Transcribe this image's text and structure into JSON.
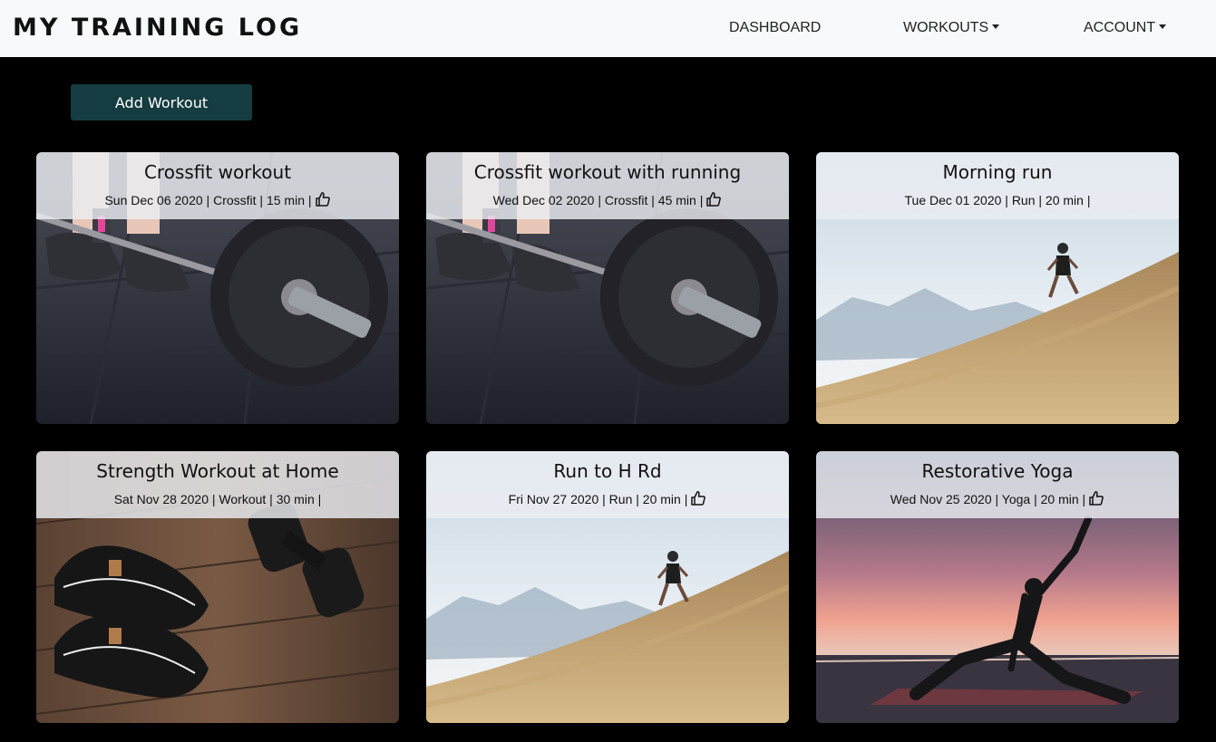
{
  "navbar": {
    "brand": "MY TRAINING LOG",
    "links": [
      {
        "label": "DASHBOARD"
      },
      {
        "label": "WORKOUTS"
      },
      {
        "label": "ACCOUNT"
      }
    ]
  },
  "actions": {
    "add_workout_label": "Add Workout"
  },
  "workouts": [
    {
      "title": "Crossfit workout",
      "date": "Sun Dec 06 2020",
      "type": "Crossfit",
      "duration": "15 min",
      "liked": true,
      "image": "barbell-icon"
    },
    {
      "title": "Crossfit workout with running",
      "date": "Wed Dec 02 2020",
      "type": "Crossfit",
      "duration": "45 min",
      "liked": true,
      "image": "barbell-icon"
    },
    {
      "title": "Morning run",
      "date": "Tue Dec 01 2020",
      "type": "Run",
      "duration": "20 min",
      "liked": false,
      "image": "runner-icon"
    },
    {
      "title": "Strength Workout at Home",
      "date": "Sat Nov 28 2020",
      "type": "Workout",
      "duration": "30 min",
      "liked": false,
      "image": "dumbbell-icon"
    },
    {
      "title": "Run to H Rd",
      "date": "Fri Nov 27 2020",
      "type": "Run",
      "duration": "20 min",
      "liked": true,
      "image": "runner-icon"
    },
    {
      "title": "Restorative Yoga",
      "date": "Wed Nov 25 2020",
      "type": "Yoga",
      "duration": "20 min",
      "liked": true,
      "image": "yoga-icon"
    }
  ],
  "colors": {
    "background": "#000000",
    "navbar": "#f8f9fa",
    "button": "#143c41"
  }
}
